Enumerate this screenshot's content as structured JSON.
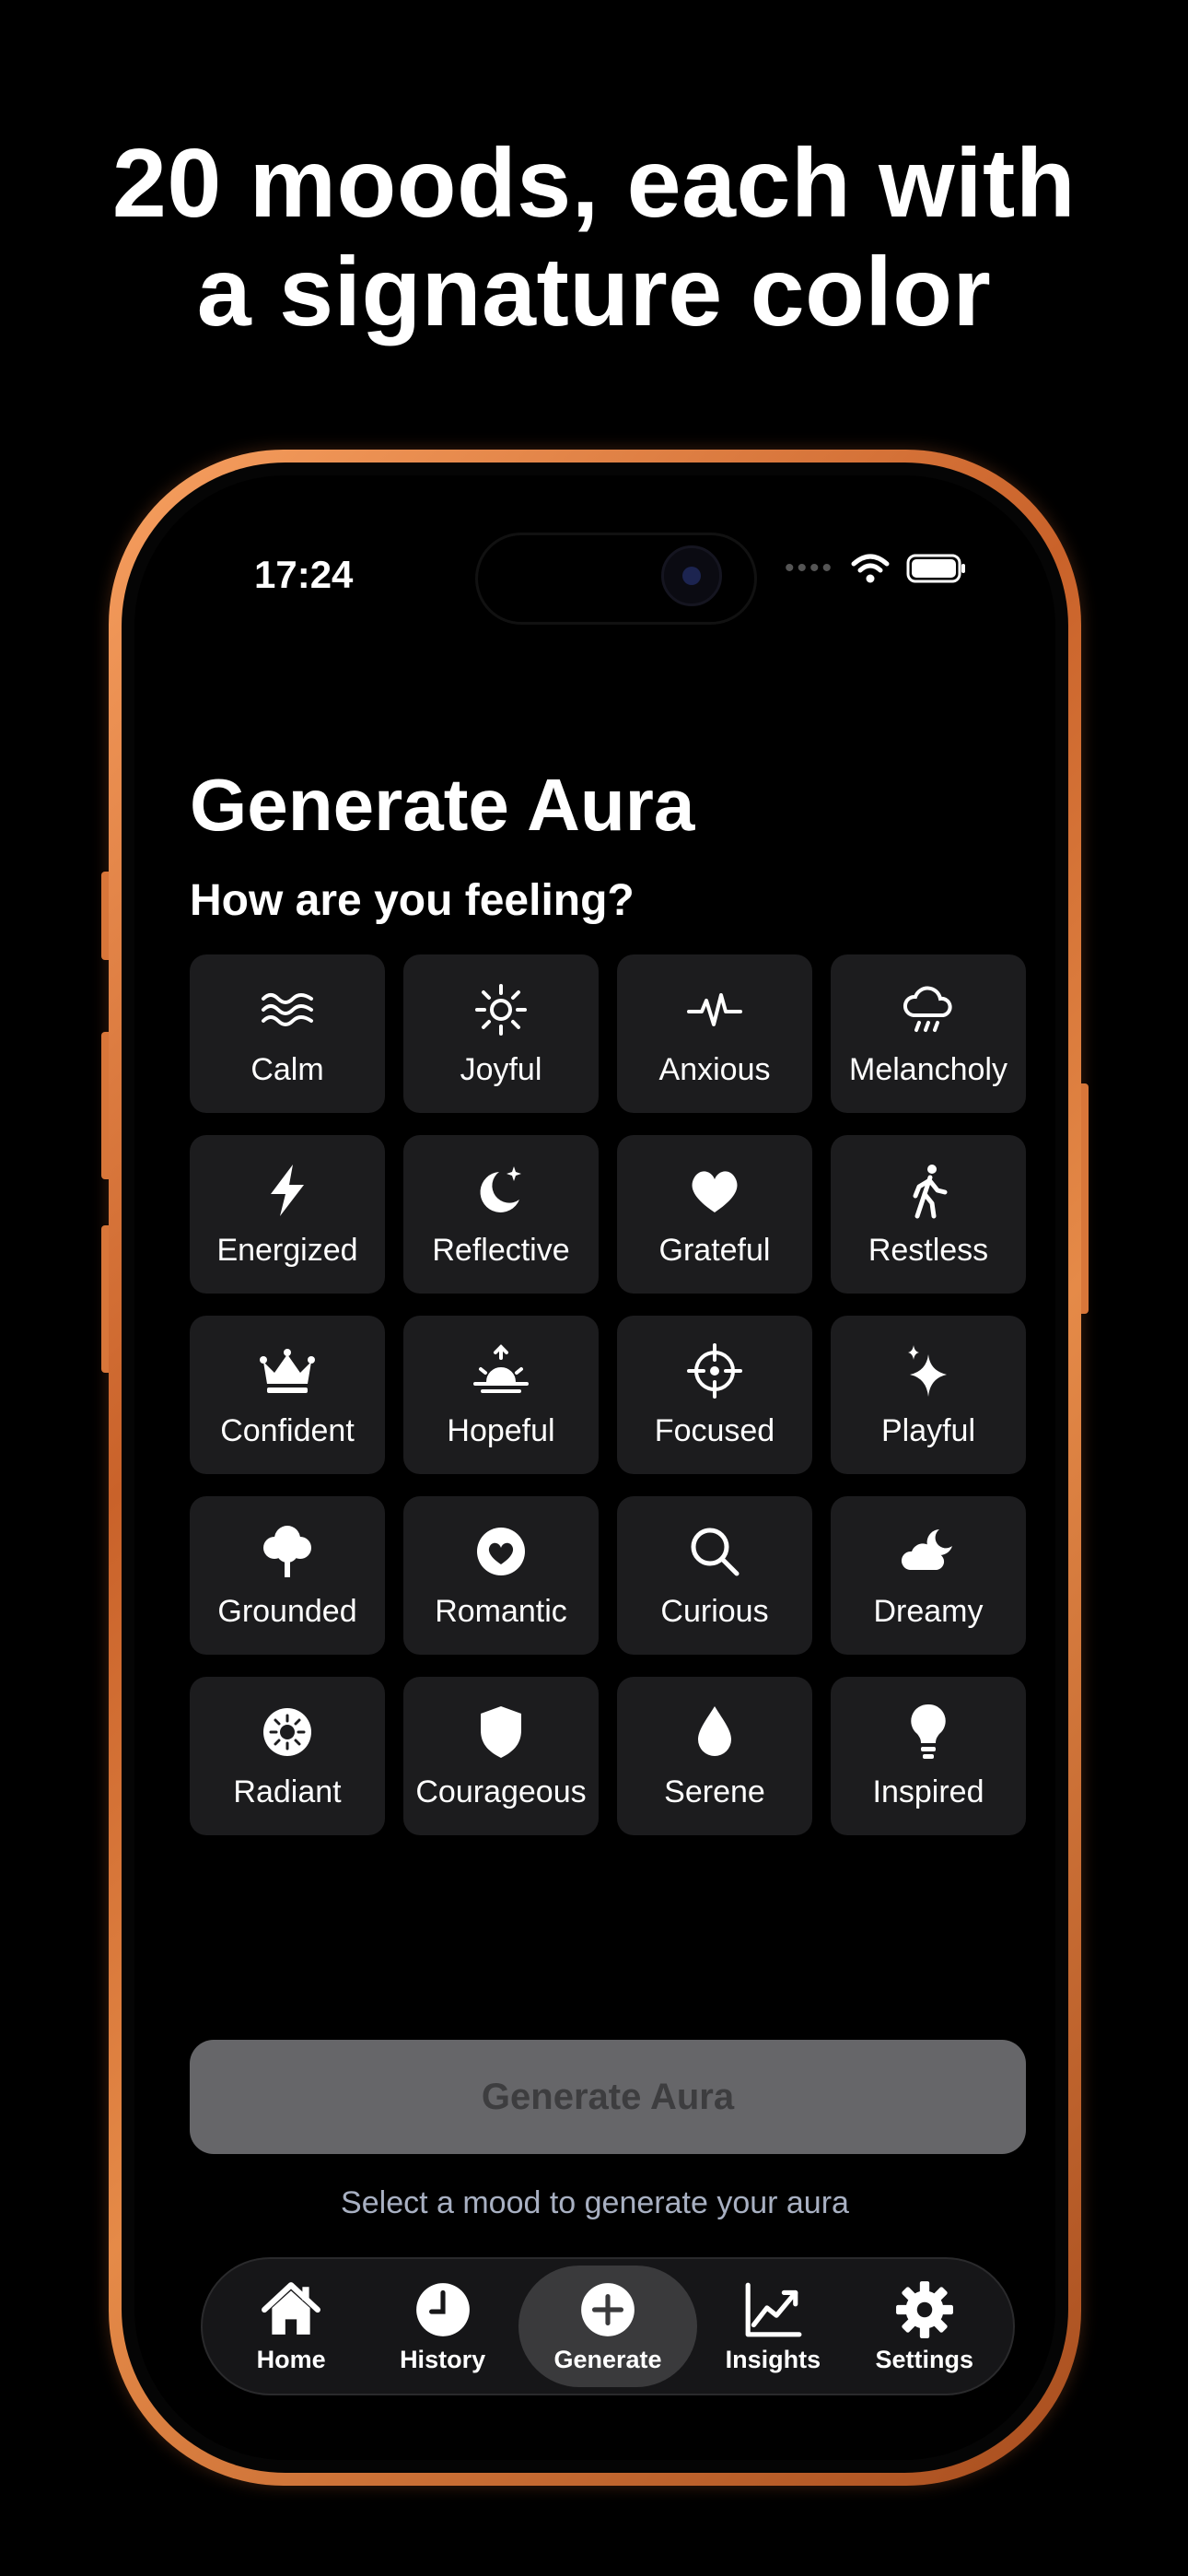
{
  "headline": {
    "line1": "20 moods, each with",
    "line2": "a signature color"
  },
  "status": {
    "time": "17:24"
  },
  "screen": {
    "title": "Generate Aura",
    "subtitle": "How are you feeling?",
    "moods": [
      {
        "label": "Calm",
        "icon": "waves-icon"
      },
      {
        "label": "Joyful",
        "icon": "sun-icon"
      },
      {
        "label": "Anxious",
        "icon": "pulse-icon"
      },
      {
        "label": "Melancholy",
        "icon": "cloud-rain-icon"
      },
      {
        "label": "Energized",
        "icon": "bolt-icon"
      },
      {
        "label": "Reflective",
        "icon": "moon-stars-icon"
      },
      {
        "label": "Grateful",
        "icon": "heart-icon"
      },
      {
        "label": "Restless",
        "icon": "walking-icon"
      },
      {
        "label": "Confident",
        "icon": "crown-icon"
      },
      {
        "label": "Hopeful",
        "icon": "sunrise-icon"
      },
      {
        "label": "Focused",
        "icon": "crosshair-icon"
      },
      {
        "label": "Playful",
        "icon": "sparkles-icon"
      },
      {
        "label": "Grounded",
        "icon": "tree-icon"
      },
      {
        "label": "Romantic",
        "icon": "heart-circle-icon"
      },
      {
        "label": "Curious",
        "icon": "magnifier-icon"
      },
      {
        "label": "Dreamy",
        "icon": "cloud-moon-icon"
      },
      {
        "label": "Radiant",
        "icon": "sun-circle-icon"
      },
      {
        "label": "Courageous",
        "icon": "shield-icon"
      },
      {
        "label": "Serene",
        "icon": "drop-icon"
      },
      {
        "label": "Inspired",
        "icon": "lightbulb-icon"
      }
    ],
    "generate_label": "Generate Aura",
    "hint": "Select a mood to generate your aura"
  },
  "tabs": [
    {
      "label": "Home",
      "icon": "house-icon"
    },
    {
      "label": "History",
      "icon": "clock-icon"
    },
    {
      "label": "Generate",
      "icon": "plus-circle-icon",
      "active": true
    },
    {
      "label": "Insights",
      "icon": "chart-icon"
    },
    {
      "label": "Settings",
      "icon": "gear-icon"
    }
  ],
  "colors": {
    "frame": "#d7773a",
    "tile": "#1c1c1e",
    "button_disabled": "#666669",
    "hint": "#a8b0c2"
  }
}
